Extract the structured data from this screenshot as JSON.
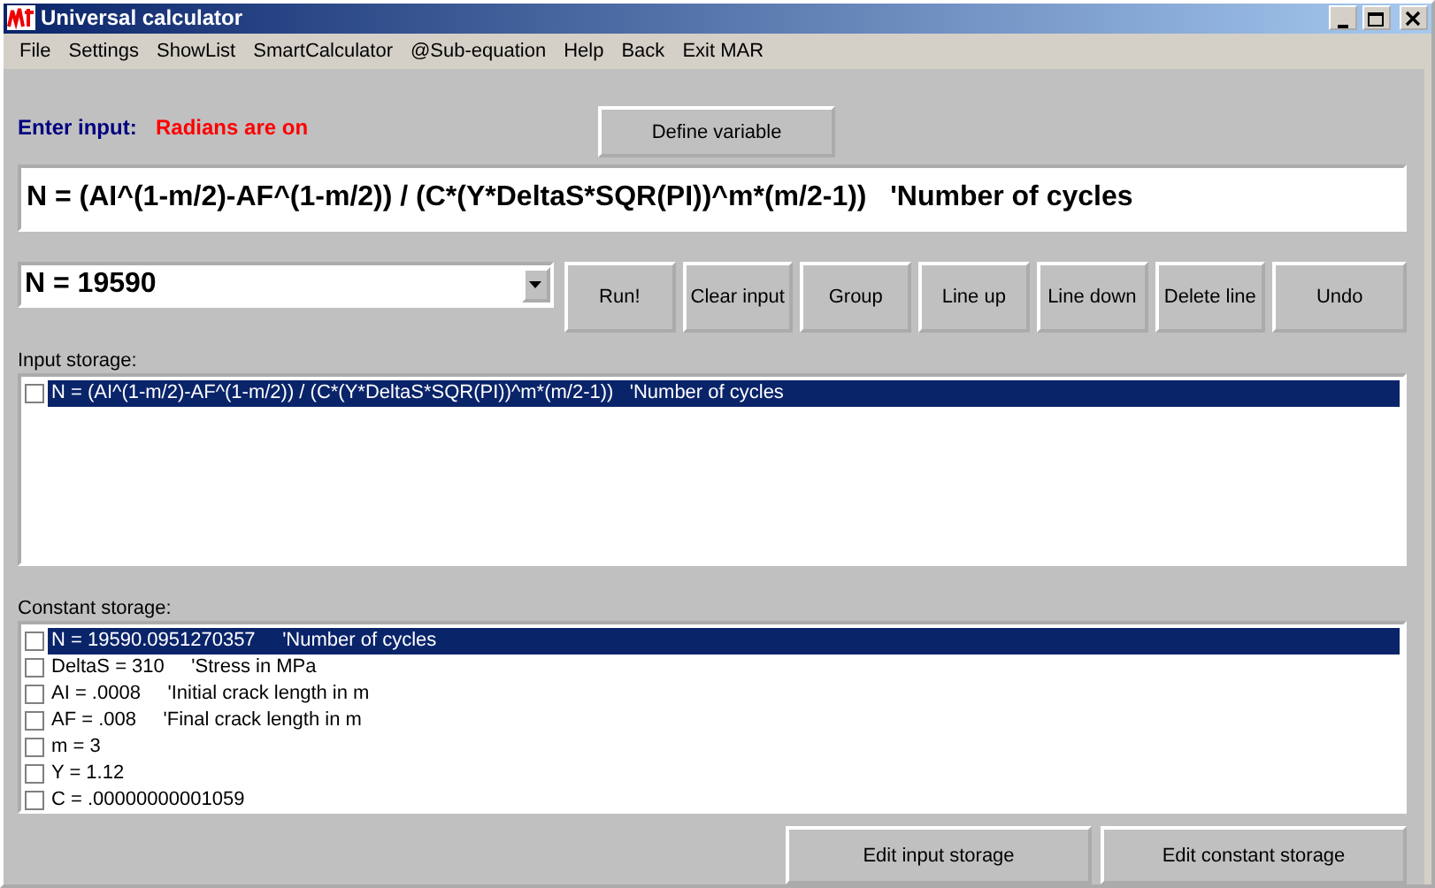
{
  "window": {
    "title": "Universal calculator"
  },
  "menu": [
    "File",
    "Settings",
    "ShowList",
    "SmartCalculator",
    "@Sub-equation",
    "Help",
    "Back",
    "Exit MAR"
  ],
  "input_label": "Enter input:",
  "mode_status": "Radians are on",
  "define_button": "Define variable",
  "input": {
    "value": "N = (AI^(1-m/2)-AF^(1-m/2)) / (C*(Y*DeltaS*SQR(PI))^m*(m/2-1))   'Number of cycles"
  },
  "result_combo": {
    "value": "N = 19590"
  },
  "buttons": [
    "Run!",
    "Clear input",
    "Group",
    "Line up",
    "Line down",
    "Delete line",
    "Undo"
  ],
  "input_storage": {
    "label": "Input storage:",
    "items": [
      {
        "text": "N = (AI^(1-m/2)-AF^(1-m/2)) / (C*(Y*DeltaS*SQR(PI))^m*(m/2-1))   'Number of cycles",
        "checked": false,
        "selected": true
      }
    ]
  },
  "constant_storage": {
    "label": "Constant storage:",
    "items": [
      {
        "text": "N = 19590.0951270357     'Number of cycles",
        "checked": false,
        "selected": true
      },
      {
        "text": "DeltaS = 310     'Stress in MPa",
        "checked": false,
        "selected": false
      },
      {
        "text": "AI = .0008     'Initial crack length in m",
        "checked": false,
        "selected": false
      },
      {
        "text": "AF = .008     'Final crack length in m",
        "checked": false,
        "selected": false
      },
      {
        "text": "m = 3",
        "checked": false,
        "selected": false
      },
      {
        "text": "Y = 1.12",
        "checked": false,
        "selected": false
      },
      {
        "text": "C = .00000000001059",
        "checked": false,
        "selected": false
      }
    ]
  },
  "bottom_buttons": [
    "Edit input storage",
    "Edit constant storage"
  ]
}
